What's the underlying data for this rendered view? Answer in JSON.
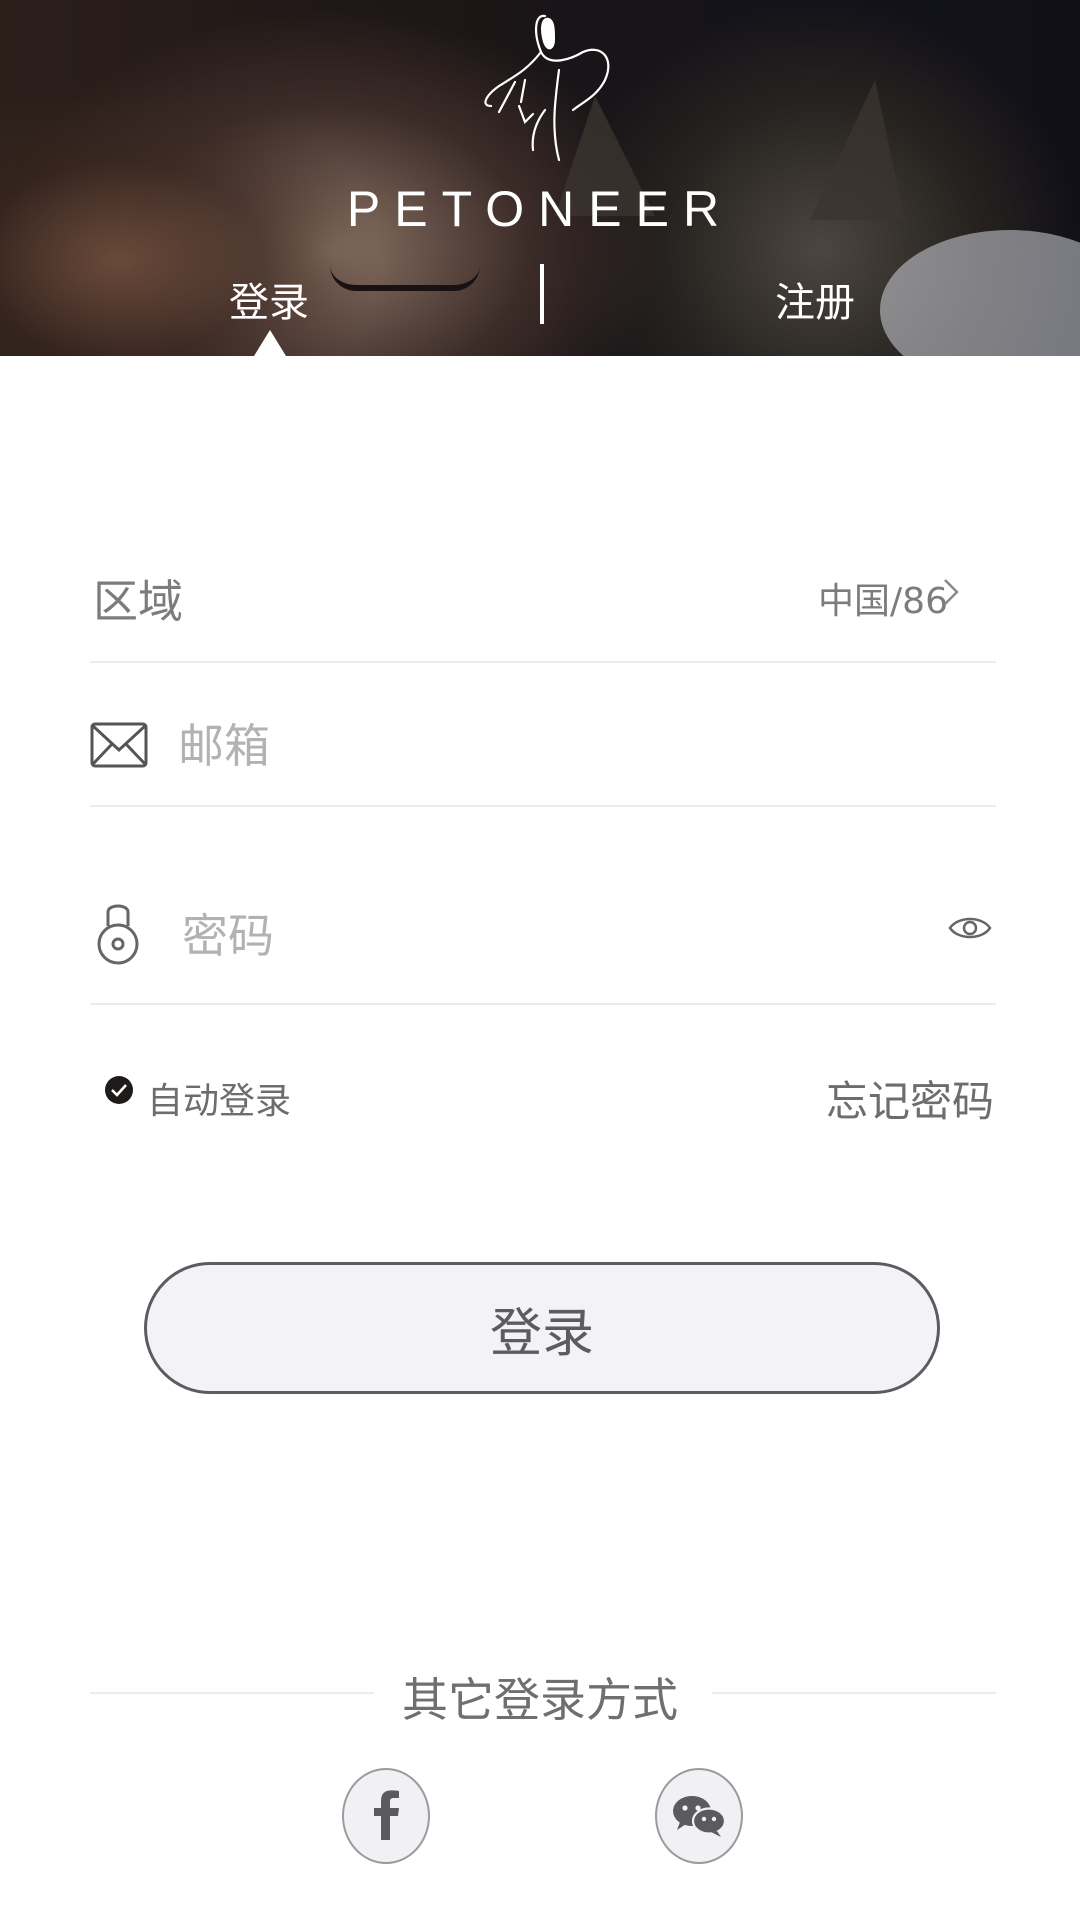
{
  "header": {
    "brand": "PETONEER",
    "tabs": [
      {
        "label": "登录",
        "active": true
      },
      {
        "label": "注册",
        "active": false
      }
    ]
  },
  "form": {
    "region": {
      "label": "区域",
      "value": "中国/86"
    },
    "email": {
      "placeholder": "邮箱",
      "value": ""
    },
    "password": {
      "placeholder": "密码",
      "value": ""
    },
    "auto_login": {
      "label": "自动登录",
      "checked": true
    },
    "forgot_password": "忘记密码",
    "submit_label": "登录"
  },
  "other_login": {
    "title": "其它登录方式",
    "providers": [
      {
        "name": "facebook",
        "icon": "facebook-icon"
      },
      {
        "name": "wechat",
        "icon": "wechat-icon"
      }
    ]
  },
  "colors": {
    "accent": "#5e5a62",
    "text_muted": "#7c7c7c",
    "divider": "#ececec"
  }
}
